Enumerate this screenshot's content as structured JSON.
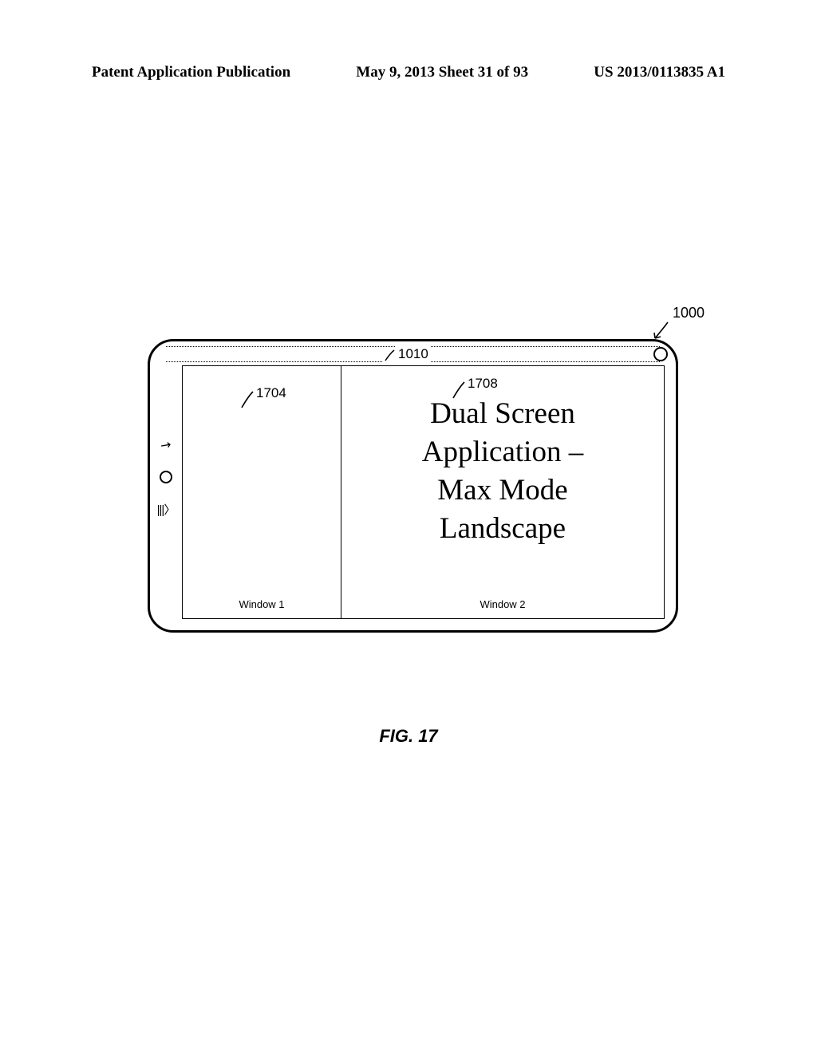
{
  "header": {
    "left": "Patent Application Publication",
    "center": "May 9, 2013  Sheet 31 of 93",
    "right": "US 2013/0113835 A1"
  },
  "refs": {
    "r1000": "1000",
    "r1010": "1010",
    "r1704": "1704",
    "r1708": "1708"
  },
  "device": {
    "left_bars": "|||〉"
  },
  "windows": {
    "w1_label": "Window 1",
    "w2_label": "Window 2",
    "w2_line1": "Dual Screen",
    "w2_line2": "Application –",
    "w2_line3": "Max Mode",
    "w2_line4": "Landscape"
  },
  "caption": "FIG. 17"
}
